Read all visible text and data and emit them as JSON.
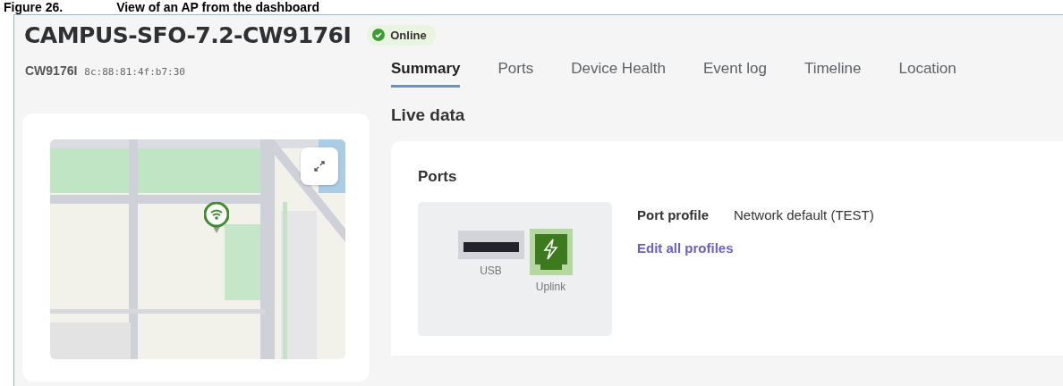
{
  "caption": {
    "number": "Figure 26.",
    "title": "View of an AP from the dashboard"
  },
  "device": {
    "name": "CAMPUS-SFO-7.2-CW9176I",
    "status": {
      "label": "Online",
      "kind": "online"
    },
    "model": "CW9176I",
    "mac": "8c:88:81:4f:b7:30"
  },
  "tabs": [
    {
      "label": "Summary",
      "selected": true
    },
    {
      "label": "Ports",
      "selected": false
    },
    {
      "label": "Device Health",
      "selected": false
    },
    {
      "label": "Event log",
      "selected": false
    },
    {
      "label": "Timeline",
      "selected": false
    },
    {
      "label": "Location",
      "selected": false
    }
  ],
  "live_data": {
    "title": "Live data",
    "ports_card": {
      "title": "Ports",
      "ports": [
        {
          "kind": "usb",
          "label": "USB"
        },
        {
          "kind": "uplink",
          "label": "Uplink"
        }
      ],
      "profile_label": "Port profile",
      "profile_value": "Network default (TEST)",
      "edit_link": "Edit all profiles"
    }
  }
}
